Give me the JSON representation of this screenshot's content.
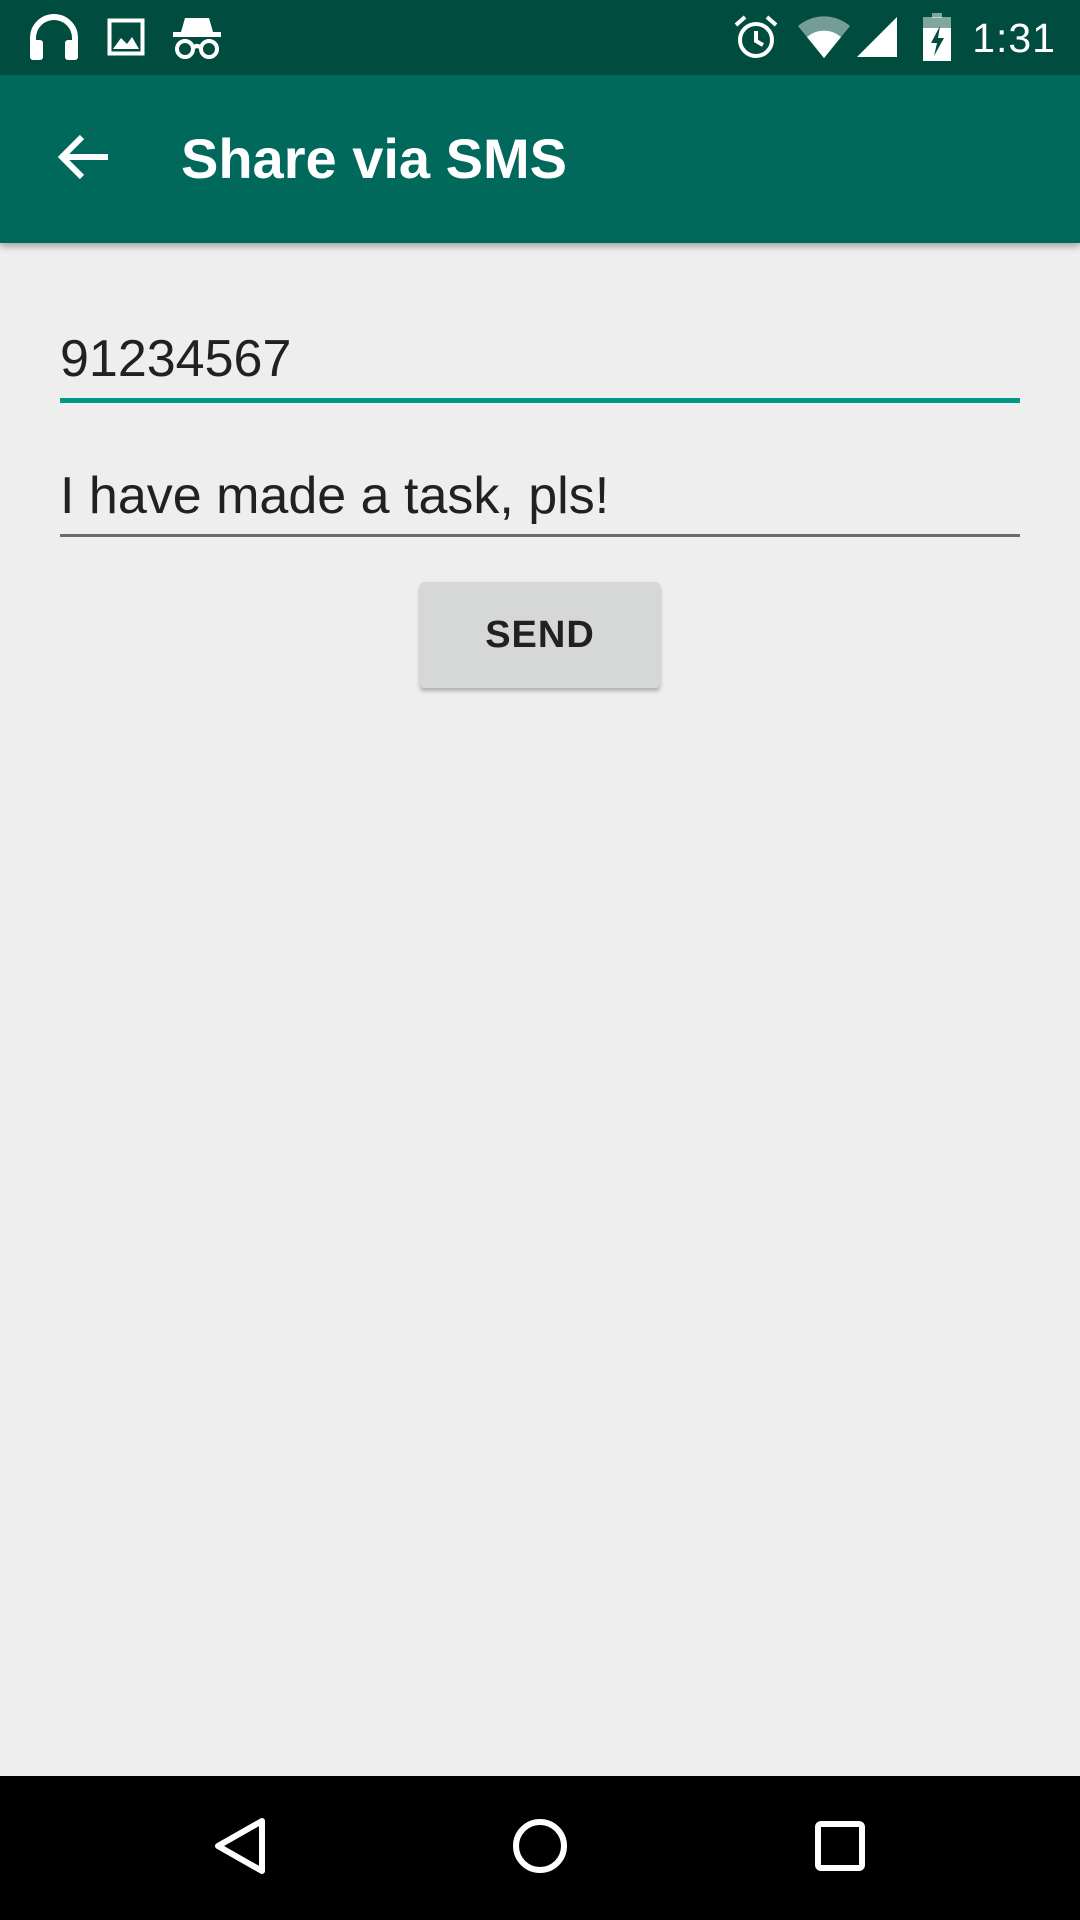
{
  "status_bar": {
    "time": "1:31",
    "left_icons": [
      "headphones-icon",
      "image-icon",
      "incognito-icon"
    ],
    "right_icons": [
      "alarm-icon",
      "wifi-icon",
      "cell-signal-icon",
      "battery-charging-icon"
    ],
    "background_color": "#004d40"
  },
  "app_bar": {
    "title": "Share via SMS",
    "back_icon": "arrow-back-icon",
    "background_color": "#00695c"
  },
  "form": {
    "phone_value": "91234567",
    "message_value": "I have made a task, pls!",
    "send_label": "SEND",
    "accent_color": "#009688"
  },
  "nav_bar": {
    "buttons": [
      "back-triangle-icon",
      "home-circle-icon",
      "recents-square-icon"
    ]
  }
}
